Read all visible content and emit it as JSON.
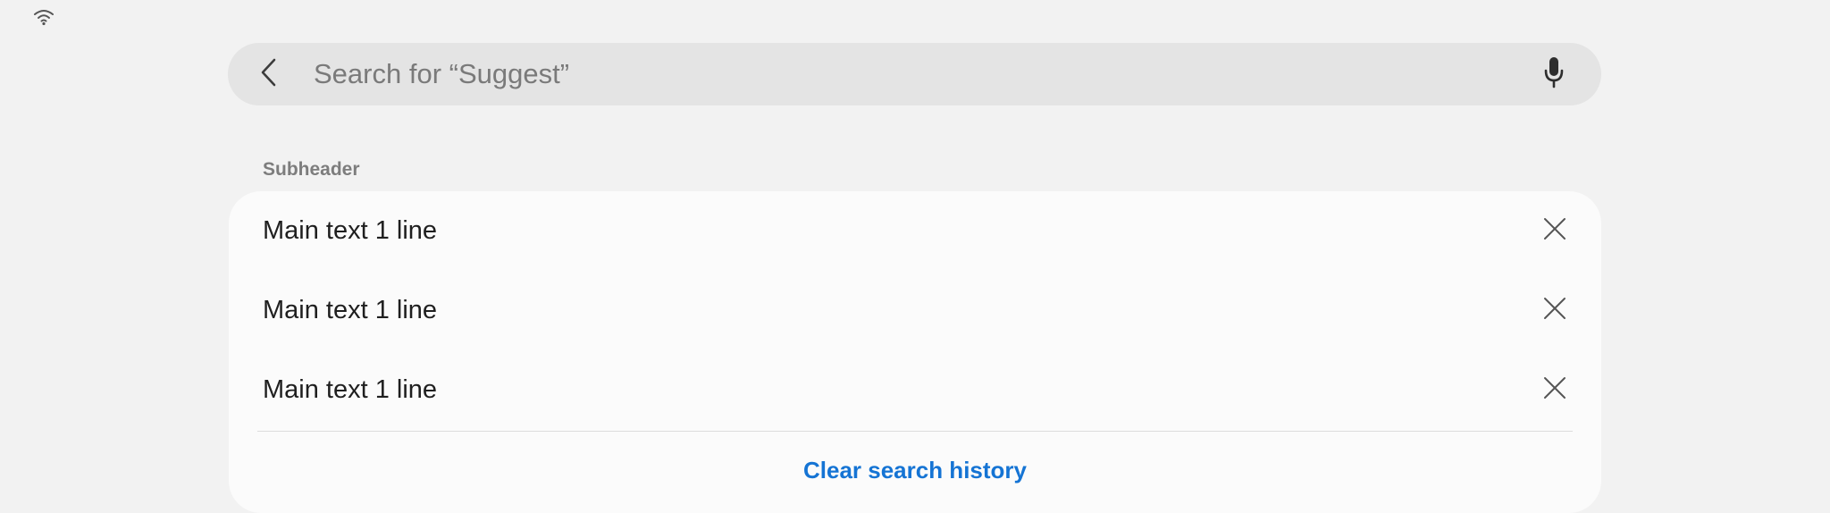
{
  "search": {
    "placeholder": "Search for “Suggest”",
    "value": ""
  },
  "subheader": "Subheader",
  "history": {
    "items": [
      {
        "label": "Main text 1 line"
      },
      {
        "label": "Main text 1 line"
      },
      {
        "label": "Main text 1 line"
      }
    ],
    "clear_label": "Clear search history"
  },
  "icons": {
    "status": "wifi-icon",
    "back": "chevron-left-icon",
    "mic": "microphone-icon",
    "remove": "close-icon"
  },
  "colors": {
    "background": "#f2f2f2",
    "search_bar": "#e4e4e4",
    "card": "#fbfbfb",
    "accent": "#1574d4",
    "text": "#1f1f1f",
    "subheader": "#7d7d7d"
  }
}
